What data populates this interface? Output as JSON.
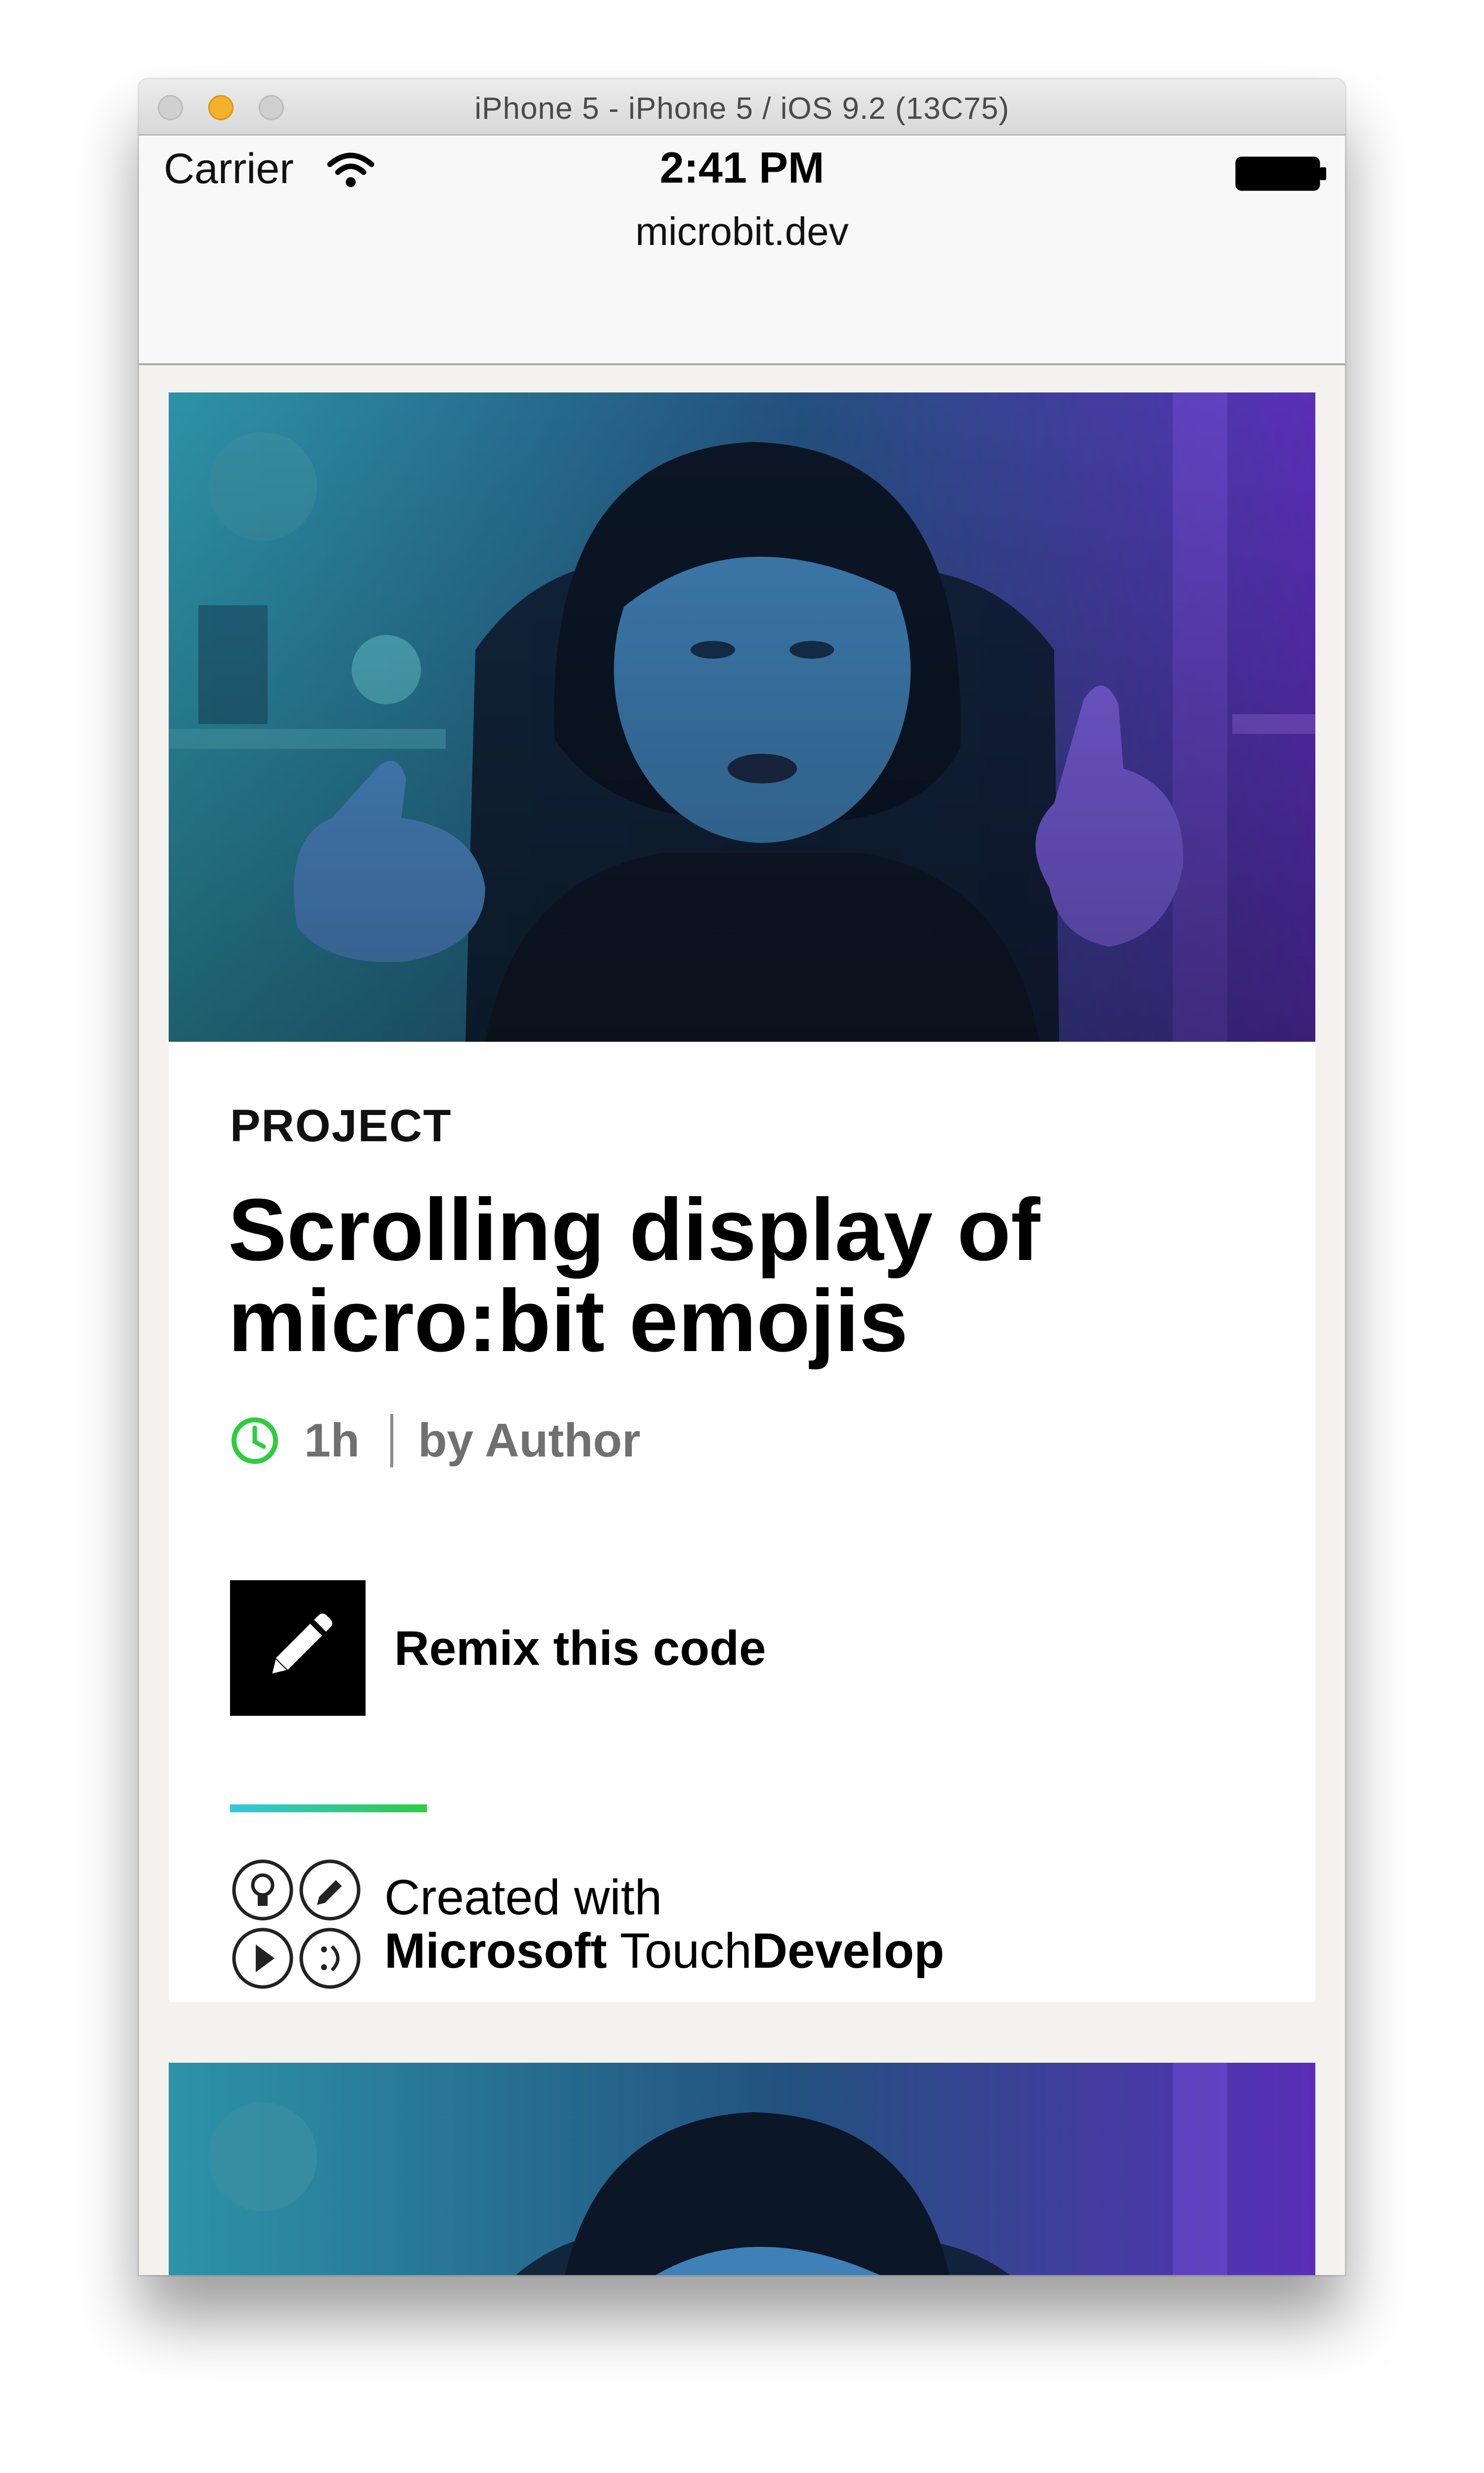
{
  "window": {
    "title": "iPhone 5 - iPhone 5 / iOS 9.2 (13C75)"
  },
  "status_bar": {
    "carrier": "Carrier",
    "time": "2:41 PM"
  },
  "address_bar": {
    "url": "microbit.dev"
  },
  "card": {
    "kicker": "PROJECT",
    "title": "Scrolling display of micro:bit emojis",
    "duration": "1h",
    "byline": "by Author",
    "remix_label": "Remix this code",
    "created_with": {
      "prefix": "Created with",
      "brand_bold": "Microsoft",
      "brand_light": "Touch",
      "brand_bold_2": "Develop"
    }
  },
  "icons": {
    "wifi": "wifi-icon",
    "battery": "battery-icon",
    "clock": "clock-icon",
    "remix": "pencil-icon",
    "touchdevelop": [
      "lightbulb-icon",
      "pencil-icon",
      "play-icon",
      "smiley-icon"
    ]
  },
  "colors": {
    "accent_green": "#2ecc40",
    "accent_cyan": "#30c8e0",
    "hero_tint_left": "#2c8fa6",
    "hero_tint_right": "#6a32c8"
  }
}
